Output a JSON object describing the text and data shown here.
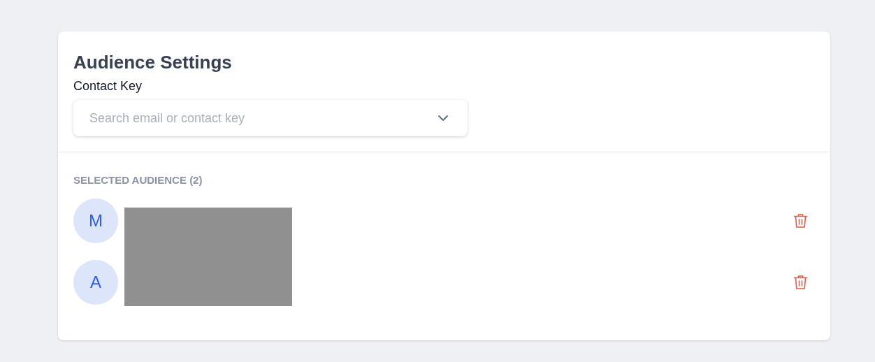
{
  "card": {
    "title": "Audience Settings",
    "contact_key": {
      "label": "Contact Key",
      "placeholder": "Search email or contact key"
    },
    "selected_audience": {
      "heading": "SELECTED AUDIENCE (2)",
      "names_redacted": true,
      "members": [
        {
          "initial": "M"
        },
        {
          "initial": "A"
        }
      ]
    }
  }
}
